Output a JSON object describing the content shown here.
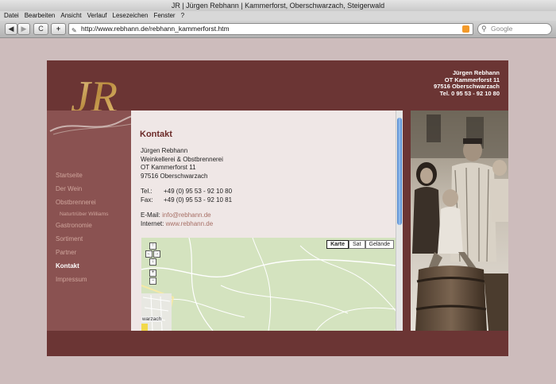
{
  "window": {
    "title": "JR | Jürgen Rebhann | Kammerforst, Oberschwarzach, Steigerwald"
  },
  "menu": [
    "Datei",
    "Bearbeiten",
    "Ansicht",
    "Verlauf",
    "Lesezeichen",
    "Fenster",
    "?"
  ],
  "toolbar": {
    "back": "◀",
    "forward": "▶",
    "reload": "C",
    "add": "+",
    "url": "http://www.rebhann.de/rebhann_kammerforst.htm",
    "search_placeholder": "Google"
  },
  "header": {
    "logo": "JR",
    "info": [
      "Jürgen Rebhann",
      "OT Kammerforst 11",
      "97516 Oberschwarzach",
      "Tel. 0 95 53 - 92 10 80"
    ]
  },
  "nav": [
    {
      "label": "Startseite"
    },
    {
      "label": "Der Wein"
    },
    {
      "label": "Obstbrennerei"
    },
    {
      "label": "Naturtrüber Williams"
    },
    {
      "label": "Gastronomie"
    },
    {
      "label": "Sortiment"
    },
    {
      "label": "Partner"
    },
    {
      "label": "Kontakt"
    },
    {
      "label": "Impressum"
    }
  ],
  "contact": {
    "title": "Kontakt",
    "name": "Jürgen Rebhann",
    "company": "Weinkellerei & Obstbrennerei",
    "street": "OT Kammerforst 11",
    "city": "97516 Oberschwarzach",
    "tel_label": "Tel.:",
    "tel": "+49 (0) 95 53 - 92 10 80",
    "fax_label": "Fax:",
    "fax": "+49 (0) 95 53 - 92 10 81",
    "email_label": "E-Mail:",
    "email": "info@rebhann.de",
    "web_label": "Internet:",
    "web": "www.rebhann.de"
  },
  "map": {
    "buttons": [
      "Karte",
      "Sat",
      "Gelände"
    ],
    "active": "Karte",
    "label": "warzach"
  }
}
